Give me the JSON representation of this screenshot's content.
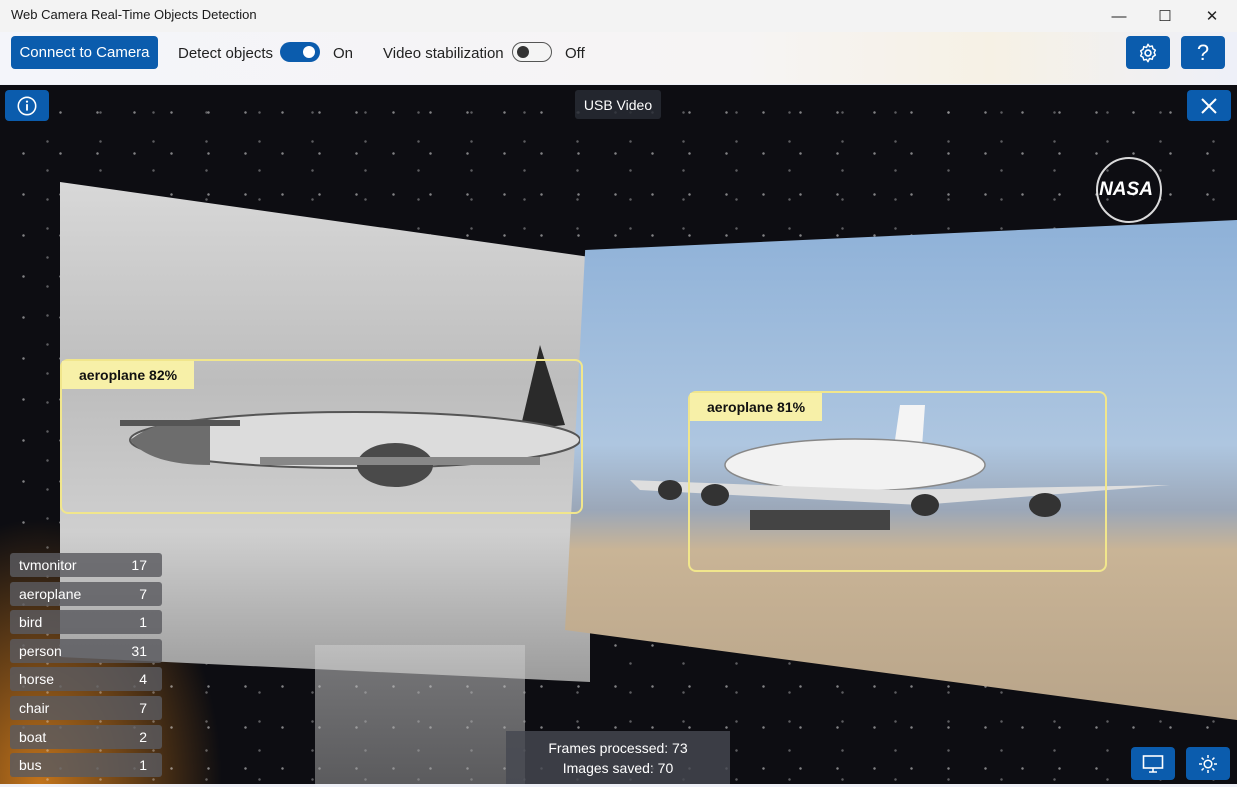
{
  "window": {
    "title": "Web Camera Real-Time Objects Detection",
    "minimize_glyph": "—",
    "maximize_glyph": "☐",
    "close_glyph": "✕"
  },
  "toolbar": {
    "connect_label": "Connect to Camera",
    "detect_label": "Detect objects",
    "detect_state": "On",
    "stabilization_label": "Video stabilization",
    "stabilization_state": "Off",
    "settings_icon": "gear-icon",
    "help_icon": "question-icon",
    "help_glyph": "?"
  },
  "video": {
    "source_label": "USB Video",
    "info_icon": "info-icon",
    "close_icon": "close-icon",
    "watermark": "NASA",
    "detections": [
      {
        "label": "aeroplane 82%"
      },
      {
        "label": "aeroplane 81%"
      }
    ],
    "counts": [
      {
        "name": "tvmonitor",
        "count": "17"
      },
      {
        "name": "aeroplane",
        "count": "7"
      },
      {
        "name": "bird",
        "count": "1"
      },
      {
        "name": "person",
        "count": "31"
      },
      {
        "name": "horse",
        "count": "4"
      },
      {
        "name": "chair",
        "count": "7"
      },
      {
        "name": "boat",
        "count": "2"
      },
      {
        "name": "bus",
        "count": "1"
      }
    ],
    "stats": {
      "frames": "Frames processed: 73",
      "images": "Images saved: 70"
    },
    "monitor_icon": "monitor-icon",
    "brightness_icon": "brightness-icon"
  },
  "colors": {
    "accent": "#0b5cad",
    "bbox": "#f1e68c",
    "bbox_label_bg": "#f7f0a8"
  }
}
